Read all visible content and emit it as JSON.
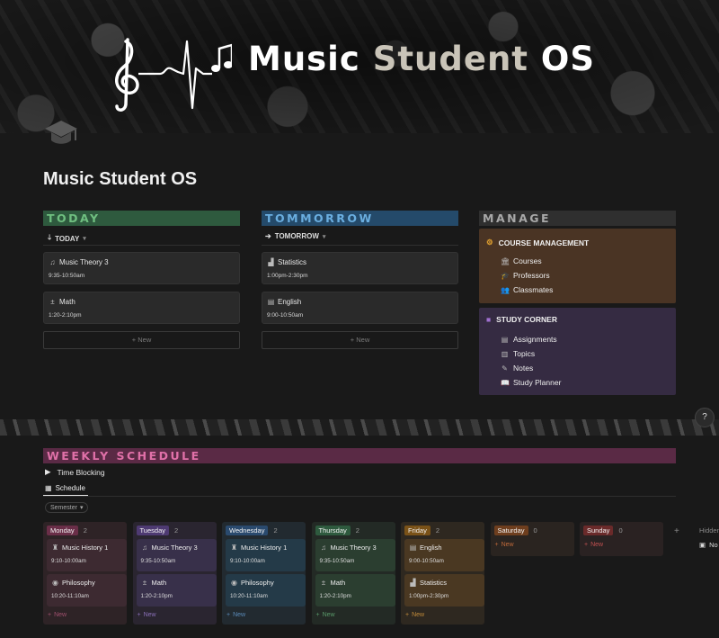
{
  "banner": {
    "title_part1": "Music",
    "title_part2": "Student",
    "title_part3": "OS"
  },
  "page": {
    "title": "Music Student OS",
    "icon": "graduation-cap-icon"
  },
  "today": {
    "heading": "TODAY",
    "color": "#2e5a3e",
    "view_label": "TODAY",
    "items": [
      {
        "title": "Music Theory 3",
        "time": "9:35-10:50am",
        "icon": "music-note-icon"
      },
      {
        "title": "Math",
        "time": "1:20-2:10pm",
        "icon": "calculator-icon"
      }
    ],
    "new_label": "New"
  },
  "tomorrow": {
    "heading": "TOMMORROW",
    "color": "#244a6a",
    "view_label": "TOMORROW",
    "items": [
      {
        "title": "Statistics",
        "time": "1:00pm-2:30pm",
        "icon": "chart-icon"
      },
      {
        "title": "English",
        "time": "9:00-10:50am",
        "icon": "book-icon"
      }
    ],
    "new_label": "New"
  },
  "manage": {
    "heading": "MANAGE",
    "course": {
      "title": "COURSE MANAGEMENT",
      "color": "#4a3424",
      "items": [
        {
          "label": "Courses",
          "icon": "building-icon"
        },
        {
          "label": "Professors",
          "icon": "graduation-cap-icon"
        },
        {
          "label": "Classmates",
          "icon": "people-icon"
        }
      ]
    },
    "study": {
      "title": "STUDY CORNER",
      "color": "#352b42",
      "items": [
        {
          "label": "Assignments",
          "icon": "document-icon"
        },
        {
          "label": "Topics",
          "icon": "books-icon"
        },
        {
          "label": "Notes",
          "icon": "pencil-icon"
        },
        {
          "label": "Study Planner",
          "icon": "open-book-icon"
        }
      ]
    }
  },
  "help_label": "?",
  "weekly": {
    "heading": "WEEKLY SCHEDULE",
    "color": "#5a2a45",
    "toggle_label": "Time Blocking",
    "tab_label": "Schedule",
    "filter_label": "Semester",
    "new_label": "New",
    "hidden_label": "Hidden",
    "hidden_item": "No",
    "columns": [
      {
        "day": "Monday",
        "count": "2",
        "tag_color": "#6a2e48",
        "bg": "#2e2326",
        "card": "#3d2a31",
        "new_color": "#a0506e",
        "items": [
          {
            "title": "Music History 1",
            "time": "9:10-10:00am"
          },
          {
            "title": "Philosophy",
            "time": "10:20-11:10am"
          }
        ]
      },
      {
        "day": "Tuesday",
        "count": "2",
        "tag_color": "#4e3a72",
        "bg": "#2a2530",
        "card": "#38304a",
        "new_color": "#8a70b8",
        "items": [
          {
            "title": "Music Theory 3",
            "time": "9:35-10:50am"
          },
          {
            "title": "Math",
            "time": "1:20-2:10pm"
          }
        ]
      },
      {
        "day": "Wednesday",
        "count": "2",
        "tag_color": "#2a4a6e",
        "bg": "#222a30",
        "card": "#243a48",
        "new_color": "#5a8ab8",
        "items": [
          {
            "title": "Music History 1",
            "time": "9:10-10:00am"
          },
          {
            "title": "Philosophy",
            "time": "10:20-11:10am"
          }
        ]
      },
      {
        "day": "Thursday",
        "count": "2",
        "tag_color": "#2e5a3e",
        "bg": "#232a25",
        "card": "#2b3e30",
        "new_color": "#5a9a6a",
        "items": [
          {
            "title": "Music Theory 3",
            "time": "9:35-10:50am"
          },
          {
            "title": "Math",
            "time": "1:20-2:10pm"
          }
        ]
      },
      {
        "day": "Friday",
        "count": "2",
        "tag_color": "#7a5218",
        "bg": "#2e2820",
        "card": "#4a3822",
        "new_color": "#c08a3a",
        "items": [
          {
            "title": "English",
            "time": "9:00-10:50am"
          },
          {
            "title": "Statistics",
            "time": "1:00pm-2:30pm"
          }
        ]
      },
      {
        "day": "Saturday",
        "count": "0",
        "tag_color": "#6e3e1e",
        "bg": "#2a2420",
        "card": "#3a2e24",
        "new_color": "#c06a3a",
        "items": []
      },
      {
        "day": "Sunday",
        "count": "0",
        "tag_color": "#6a2a2a",
        "bg": "#2a2222",
        "card": "#3a2a2a",
        "new_color": "#c05050",
        "items": []
      }
    ]
  }
}
